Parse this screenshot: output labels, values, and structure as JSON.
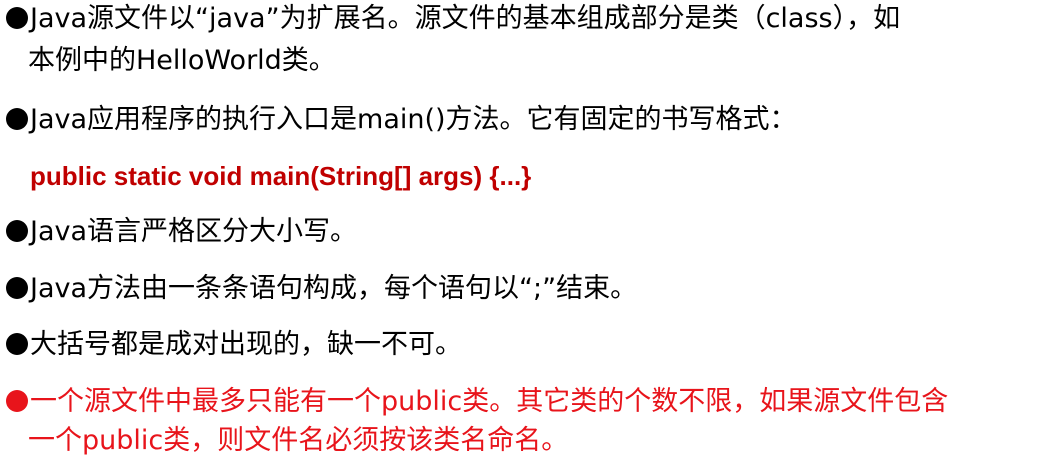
{
  "bullets": [
    {
      "line1": "Java源文件以“java”为扩展名。源文件的基本组成部分是类（class），如",
      "line2": "本例中的HelloWorld类。"
    },
    {
      "line1": "Java应用程序的执行入口是main()方法。它有固定的书写格式："
    },
    {
      "line1": "Java语言严格区分大小写。"
    },
    {
      "line1": "Java方法由一条条语句构成，每个语句以“;”结束。"
    },
    {
      "line1": "大括号都是成对出现的，缺一不可。"
    },
    {
      "line1": "一个源文件中最多只能有一个public类。其它类的个数不限，如果源文件包含",
      "line2": "一个public类，则文件名必须按该类名命名。"
    }
  ],
  "code_line": "public static void main(String[] args)  {...}",
  "colors": {
    "text": "#000000",
    "code": "#c00000",
    "highlight": "#e8141b"
  }
}
